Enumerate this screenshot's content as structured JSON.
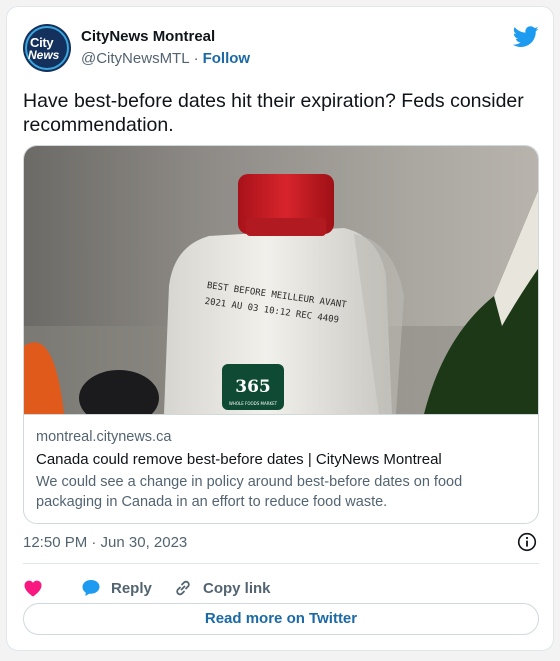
{
  "author": {
    "avatar_line1": "City",
    "avatar_line2": "News",
    "name": "CityNews Montreal",
    "handle": "@CityNewsMTL",
    "separator": "·",
    "follow_label": "Follow"
  },
  "tweet": {
    "text": "Have best-before dates hit their expiration? Feds consider recommendation.",
    "timestamp": "12:50 PM · Jun 30, 2023"
  },
  "link_card": {
    "domain": "montreal.citynews.ca",
    "title": "Canada could remove best-before dates | CityNews Montreal",
    "description": "We could see a change in policy around best-before dates on food packaging in Canada in an effort to reduce food waste.",
    "image": {
      "carton_print_line1": "BEST BEFORE MEILLEUR AVANT",
      "carton_print_line2": "2021 AU 03 10:12 REC 4409",
      "label_number": "365",
      "label_sub": "WHOLE FOODS MARKET"
    }
  },
  "actions": {
    "reply_label": "Reply",
    "copy_label": "Copy link",
    "read_more_label": "Read more on Twitter"
  },
  "colors": {
    "accent": "#1b6aa5",
    "twitter_blue": "#1d9bf0",
    "heart": "#f91880",
    "muted": "#536471"
  }
}
